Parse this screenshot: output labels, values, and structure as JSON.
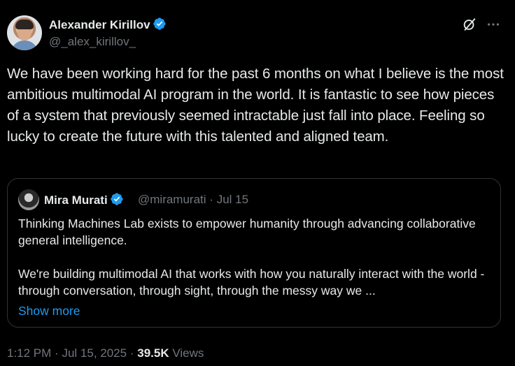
{
  "author": {
    "display_name": "Alexander Kirillov",
    "handle": "@_alex_kirillov_"
  },
  "tweet": {
    "text": "We have been working hard for the past 6 months on what I believe is the most ambitious multimodal AI program in the world. It is fantastic to see how pieces of a system that previously seemed intractable just fall into place. Feeling so lucky to create the future with this talented and aligned team."
  },
  "quoted": {
    "display_name": "Mira Murati",
    "handle": "@miramurati",
    "separator": "·",
    "date": "Jul 15",
    "text": "Thinking Machines Lab exists to empower humanity through advancing collaborative general intelligence.\n\nWe're building multimodal AI that works with how you naturally interact with the world - through conversation, through sight, through the messy way we ...",
    "show_more_label": "Show more"
  },
  "footer": {
    "time": "1:12 PM",
    "separator1": "·",
    "date": "Jul 15, 2025",
    "separator2": "·",
    "views_count": "39.5K",
    "views_label": "Views"
  },
  "icons": {
    "verified": "verified-badge-icon",
    "grok": "grok-icon",
    "more": "more-options-icon"
  },
  "colors": {
    "background": "#000000",
    "text_primary": "#e7e9ea",
    "text_secondary": "#71767b",
    "accent": "#1d9bf0",
    "border": "#2f3336"
  }
}
